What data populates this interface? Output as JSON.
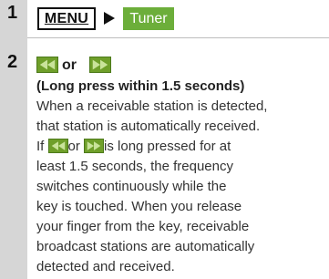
{
  "steps": [
    {
      "number": "1"
    },
    {
      "number": "2"
    }
  ],
  "step1": {
    "menu_label": "MENU",
    "tuner_label": "Tuner",
    "tuner_color": "#6cae3a"
  },
  "step2": {
    "or_label": "or",
    "long_press_note": "(Long press within 1.5 seconds)",
    "line1": "When a receivable station is detected,",
    "line2": "that station is automatically received.",
    "line3_a": "If ",
    "line3_b": "or ",
    "line3_c": "is long pressed for at",
    "line4": "least 1.5 seconds, the frequency",
    "line5": "switches continuously while the",
    "line6": "key is touched. When you release",
    "line7": "your finger from the key, receivable",
    "line8": "broadcast stations are automatically",
    "line9": "detected and received.",
    "key_color": "#6f9f2a",
    "icons": [
      "seek-back-icon",
      "seek-forward-icon"
    ]
  }
}
